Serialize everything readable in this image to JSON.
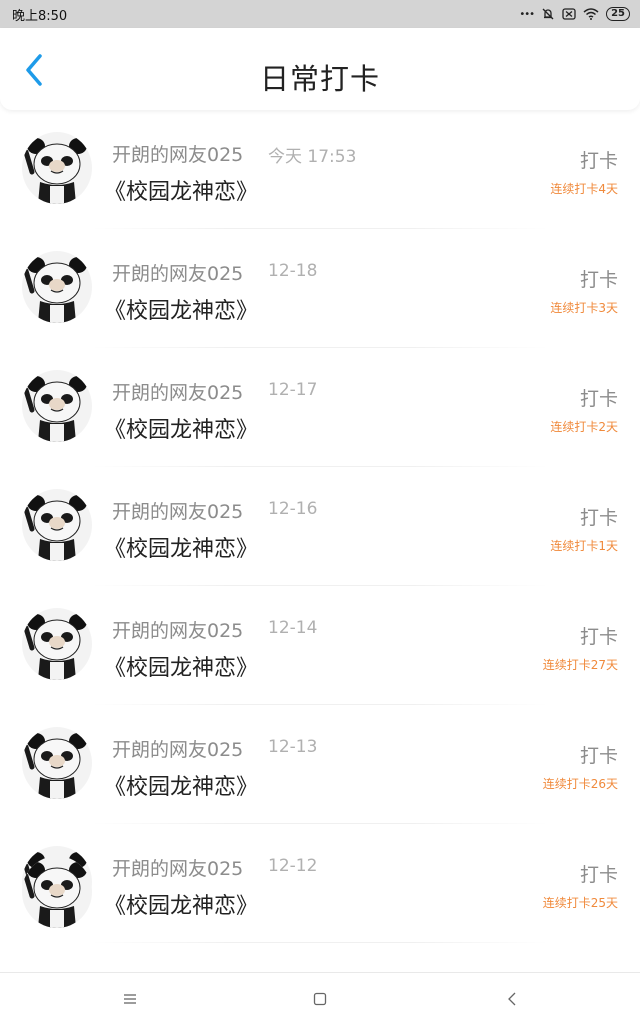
{
  "status_bar": {
    "time": "晚上8:50",
    "dots_label": "•••",
    "battery": "25",
    "icons": [
      "dots-icon",
      "bell-muted-icon",
      "sim-card-off-icon",
      "wifi-icon",
      "battery-icon"
    ]
  },
  "header": {
    "title": "日常打卡",
    "back_icon": "chevron-left-icon"
  },
  "colors": {
    "accent": "#1e9be9",
    "streak": "#f08a3c",
    "secondary_text": "#8c8c8c"
  },
  "records": [
    {
      "user": "开朗的网友025",
      "date": "今天 17:53",
      "book": "《校园龙神恋》",
      "action": "打卡",
      "streak": "连续打卡4天"
    },
    {
      "user": "开朗的网友025",
      "date": "12-18",
      "book": "《校园龙神恋》",
      "action": "打卡",
      "streak": "连续打卡3天"
    },
    {
      "user": "开朗的网友025",
      "date": "12-17",
      "book": "《校园龙神恋》",
      "action": "打卡",
      "streak": "连续打卡2天"
    },
    {
      "user": "开朗的网友025",
      "date": "12-16",
      "book": "《校园龙神恋》",
      "action": "打卡",
      "streak": "连续打卡1天"
    },
    {
      "user": "开朗的网友025",
      "date": "12-14",
      "book": "《校园龙神恋》",
      "action": "打卡",
      "streak": "连续打卡27天"
    },
    {
      "user": "开朗的网友025",
      "date": "12-13",
      "book": "《校园龙神恋》",
      "action": "打卡",
      "streak": "连续打卡26天"
    },
    {
      "user": "开朗的网友025",
      "date": "12-12",
      "book": "《校园龙神恋》",
      "action": "打卡",
      "streak": "连续打卡25天"
    }
  ],
  "nav_bar": {
    "buttons": [
      "menu-icon",
      "home-square-icon",
      "back-triangle-icon"
    ]
  }
}
